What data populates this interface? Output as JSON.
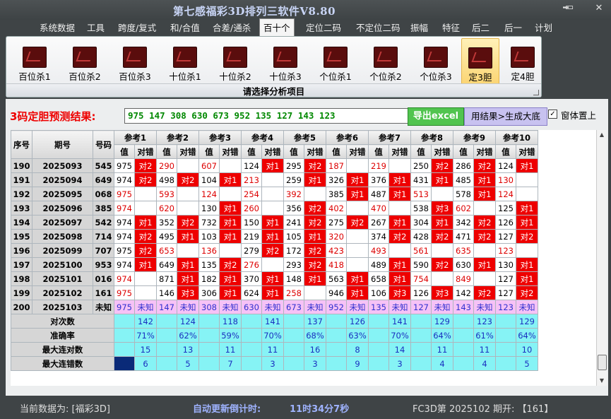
{
  "window": {
    "title": "第七感福彩3D排列三软件V8.80",
    "min": "━",
    "max": "▭",
    "close": "✕"
  },
  "menu": [
    "系统数据",
    "工具",
    "跨度/复式",
    "和/合值",
    "合差/通杀",
    "百十个",
    "定位二码",
    "不定位二码",
    "振幅",
    "特征",
    "后二",
    "后一",
    "计划"
  ],
  "menu_active": 5,
  "toolbar": {
    "buttons": [
      "百位杀1",
      "百位杀2",
      "百位杀3",
      "十位杀1",
      "十位杀2",
      "十位杀3",
      "个位杀1",
      "个位杀2",
      "个位杀3",
      "定3胆",
      "定4胆"
    ],
    "active": 9,
    "group_label": "请选择分析项目"
  },
  "prediction": {
    "label": "3码定胆预测结果:",
    "value": "975 147 308 630 673 952 135 127 143 123",
    "export_label": "导出excel",
    "generate_label": "用结果>生成大底",
    "pin_label": "窗体置上",
    "pin_checked": "✓"
  },
  "table": {
    "header": {
      "seq": "序号",
      "period": "期号",
      "number": "号码",
      "ref_prefix": "参考",
      "value": "值",
      "match": "对错"
    },
    "rows": [
      {
        "seq": "190",
        "period": "2025093",
        "number": "545",
        "cells": [
          [
            "975",
            "对2"
          ],
          [
            "290",
            ""
          ],
          [
            "607",
            ""
          ],
          [
            "124",
            "对1"
          ],
          [
            "295",
            "对2"
          ],
          [
            "187",
            ""
          ],
          [
            "219",
            ""
          ],
          [
            "250",
            "对2"
          ],
          [
            "286",
            "对2"
          ],
          [
            "124",
            "对1"
          ]
        ]
      },
      {
        "seq": "191",
        "period": "2025094",
        "number": "649",
        "cells": [
          [
            "974",
            "对2"
          ],
          [
            "498",
            "对2"
          ],
          [
            "104",
            "对1"
          ],
          [
            "213",
            ""
          ],
          [
            "259",
            "对1"
          ],
          [
            "326",
            "对1"
          ],
          [
            "376",
            "对1"
          ],
          [
            "431",
            "对1"
          ],
          [
            "485",
            "对1"
          ],
          [
            "130",
            ""
          ]
        ]
      },
      {
        "seq": "192",
        "period": "2025095",
        "number": "068",
        "cells": [
          [
            "975",
            ""
          ],
          [
            "593",
            ""
          ],
          [
            "124",
            ""
          ],
          [
            "254",
            ""
          ],
          [
            "392",
            ""
          ],
          [
            "385",
            "对1"
          ],
          [
            "487",
            "对1"
          ],
          [
            "513",
            ""
          ],
          [
            "578",
            "对1"
          ],
          [
            "124",
            ""
          ]
        ]
      },
      {
        "seq": "193",
        "period": "2025096",
        "number": "385",
        "cells": [
          [
            "974",
            ""
          ],
          [
            "620",
            ""
          ],
          [
            "130",
            "对1"
          ],
          [
            "260",
            ""
          ],
          [
            "356",
            "对2"
          ],
          [
            "402",
            ""
          ],
          [
            "470",
            ""
          ],
          [
            "538",
            "对3"
          ],
          [
            "602",
            ""
          ],
          [
            "125",
            "对1"
          ]
        ]
      },
      {
        "seq": "194",
        "period": "2025097",
        "number": "542",
        "cells": [
          [
            "974",
            "对1"
          ],
          [
            "352",
            "对2"
          ],
          [
            "732",
            "对1"
          ],
          [
            "150",
            "对1"
          ],
          [
            "241",
            "对2"
          ],
          [
            "275",
            "对2"
          ],
          [
            "267",
            "对1"
          ],
          [
            "304",
            "对1"
          ],
          [
            "342",
            "对2"
          ],
          [
            "126",
            "对1"
          ]
        ]
      },
      {
        "seq": "195",
        "period": "2025098",
        "number": "714",
        "cells": [
          [
            "974",
            "对2"
          ],
          [
            "495",
            "对1"
          ],
          [
            "103",
            "对1"
          ],
          [
            "219",
            "对1"
          ],
          [
            "105",
            "对1"
          ],
          [
            "320",
            ""
          ],
          [
            "374",
            "对2"
          ],
          [
            "428",
            "对2"
          ],
          [
            "471",
            "对2"
          ],
          [
            "127",
            "对2"
          ]
        ]
      },
      {
        "seq": "196",
        "period": "2025099",
        "number": "707",
        "cells": [
          [
            "975",
            "对2"
          ],
          [
            "653",
            ""
          ],
          [
            "136",
            ""
          ],
          [
            "279",
            "对2"
          ],
          [
            "172",
            "对2"
          ],
          [
            "423",
            ""
          ],
          [
            "493",
            ""
          ],
          [
            "561",
            ""
          ],
          [
            "635",
            ""
          ],
          [
            "123",
            ""
          ]
        ]
      },
      {
        "seq": "197",
        "period": "2025100",
        "number": "953",
        "cells": [
          [
            "974",
            "对1"
          ],
          [
            "649",
            "对1"
          ],
          [
            "135",
            "对2"
          ],
          [
            "276",
            ""
          ],
          [
            "293",
            "对2"
          ],
          [
            "418",
            ""
          ],
          [
            "489",
            "对1"
          ],
          [
            "590",
            "对2"
          ],
          [
            "630",
            "对1"
          ],
          [
            "130",
            "对1"
          ]
        ]
      },
      {
        "seq": "198",
        "period": "2025101",
        "number": "016",
        "cells": [
          [
            "974",
            ""
          ],
          [
            "871",
            "对1"
          ],
          [
            "182",
            "对1"
          ],
          [
            "370",
            "对1"
          ],
          [
            "148",
            "对1"
          ],
          [
            "563",
            "对1"
          ],
          [
            "658",
            "对1"
          ],
          [
            "754",
            ""
          ],
          [
            "849",
            ""
          ],
          [
            "127",
            "对1"
          ]
        ]
      },
      {
        "seq": "199",
        "period": "2025102",
        "number": "161",
        "cells": [
          [
            "975",
            ""
          ],
          [
            "146",
            "对3"
          ],
          [
            "306",
            "对1"
          ],
          [
            "624",
            "对1"
          ],
          [
            "258",
            ""
          ],
          [
            "946",
            "对1"
          ],
          [
            "106",
            "对3"
          ],
          [
            "126",
            "对3"
          ],
          [
            "142",
            "对2"
          ],
          [
            "127",
            "对2"
          ]
        ]
      }
    ],
    "current": {
      "seq": "200",
      "period": "2025103",
      "number": "未知",
      "values": [
        "975",
        "147",
        "308",
        "630",
        "673",
        "952",
        "135",
        "127",
        "143",
        "123"
      ],
      "status": "未知"
    },
    "stats": [
      {
        "label": "对次数",
        "values": [
          "142",
          "124",
          "118",
          "141",
          "137",
          "126",
          "141",
          "129",
          "123",
          "129"
        ]
      },
      {
        "label": "准确率",
        "values": [
          "71%",
          "62%",
          "59%",
          "70%",
          "68%",
          "63%",
          "70%",
          "64%",
          "61%",
          "64%"
        ]
      },
      {
        "label": "最大连对数",
        "values": [
          "15",
          "13",
          "11",
          "11",
          "16",
          "8",
          "14",
          "11",
          "11",
          "10"
        ]
      },
      {
        "label": "最大连错数",
        "values": [
          "6",
          "5",
          "7",
          "3",
          "3",
          "9",
          "3",
          "4",
          "4",
          "5"
        ]
      }
    ]
  },
  "status": {
    "current_data": "当前数据为: [福彩3D]",
    "countdown_label": "自动更新倒计时:",
    "countdown_value": "11时34分7秒",
    "issue": "FC3D第 2025102 期开: 【161】"
  }
}
